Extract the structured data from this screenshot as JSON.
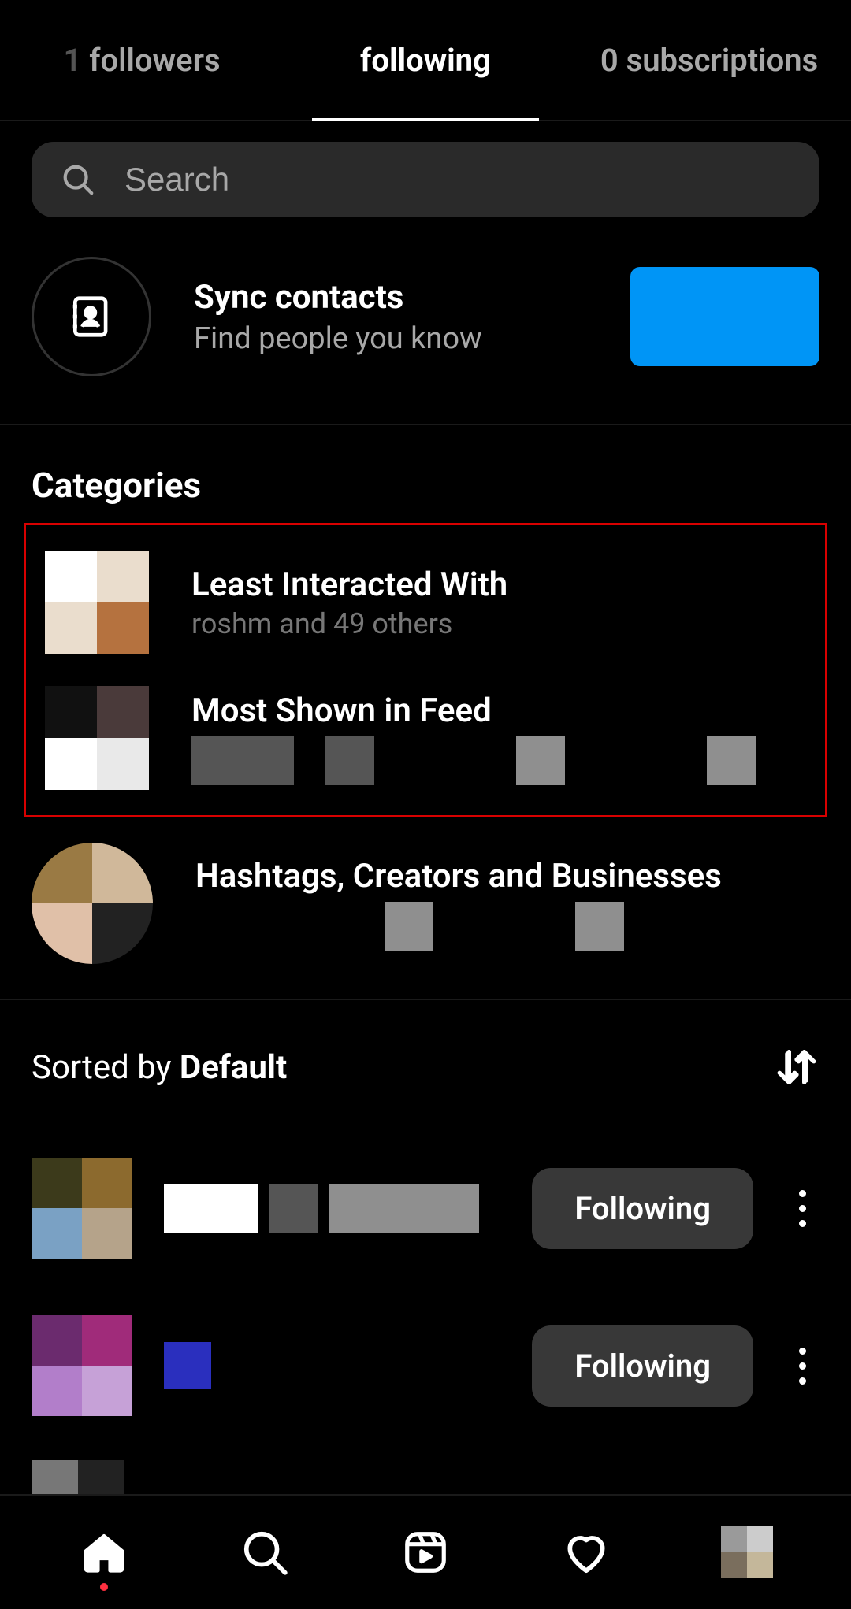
{
  "tabs": {
    "followers": "followers",
    "followers_prefix_char": "1",
    "following": "following",
    "subscriptions": "0 subscriptions"
  },
  "search": {
    "placeholder": "Search"
  },
  "syncContacts": {
    "title": "Sync contacts",
    "subtitle": "Find people you know"
  },
  "categoriesHeader": "Categories",
  "categories": {
    "leastInteracted": {
      "title": "Least Interacted With",
      "subtitle": "roshm           and 49 others"
    },
    "mostShown": {
      "title": "Most Shown in Feed"
    },
    "hashtags": {
      "title": "Hashtags, Creators and Businesses"
    }
  },
  "sorted": {
    "prefix": "Sorted by ",
    "value": "Default"
  },
  "followButtonLabel": "Following",
  "rows": [
    {
      "name_redacted": true
    },
    {
      "name_redacted": true
    },
    {
      "name_redacted": true
    }
  ]
}
